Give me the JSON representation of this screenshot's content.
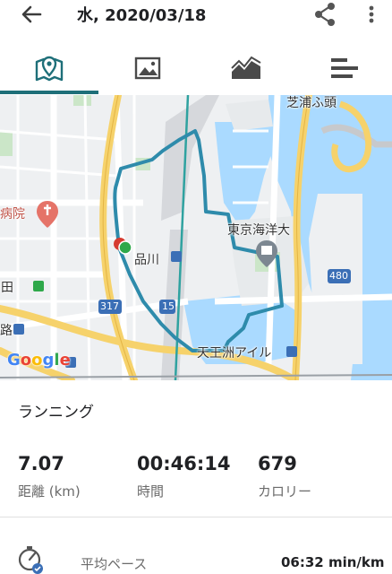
{
  "header": {
    "title": "水, 2020/03/18",
    "back_icon": "arrow-back-icon",
    "share_icon": "share-icon",
    "more_icon": "more-vert-icon"
  },
  "tabs": [
    {
      "name": "map",
      "icon": "map-pin-icon",
      "selected": true
    },
    {
      "name": "photos",
      "icon": "image-icon",
      "selected": false
    },
    {
      "name": "chart",
      "icon": "area-chart-icon",
      "selected": false
    },
    {
      "name": "splits",
      "icon": "bar-list-icon",
      "selected": false
    }
  ],
  "map": {
    "labels": {
      "hospital": "病院",
      "shinagawa": "品川",
      "tokyo_kaiyo": "東京海洋大",
      "tennozu_isle": "天王洲アイル",
      "shibaura": "芝浦ふ頭",
      "road_317": "317",
      "road_15": "15",
      "road_480": "480",
      "ta": "田",
      "ro": "路"
    },
    "attribution": "Google",
    "route_color": "#2e8bab"
  },
  "activity": {
    "type": "ランニング",
    "stats": [
      {
        "value": "7.07",
        "label": "距離 (km)"
      },
      {
        "value": "00:46:14",
        "label": "時間"
      },
      {
        "value": "679",
        "label": "カロリー"
      }
    ],
    "pace": {
      "label": "平均ペース",
      "value": "06:32 min/km",
      "icon": "pace-gauge-icon"
    }
  },
  "colors": {
    "accent": "#1e6f79",
    "text": "#202124",
    "secondary_text": "#6b6b6b",
    "water": "#aadaff",
    "route": "#2e8bab"
  }
}
